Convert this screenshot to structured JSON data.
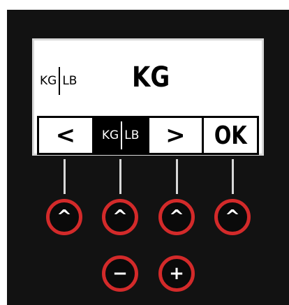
{
  "display": {
    "unit_label_left": "KG",
    "unit_label_right": "LB",
    "unit_value": "KG"
  },
  "softkeys": {
    "prev": "<",
    "toggle_left": "KG",
    "toggle_right": "LB",
    "next": ">",
    "ok": "OK"
  },
  "buttons": {
    "up_glyph": "^",
    "minus_glyph": "−",
    "plus_glyph": "+"
  },
  "colors": {
    "panel": "#121212",
    "button_ring": "#d32a2a",
    "lcd": "#ffffff"
  }
}
